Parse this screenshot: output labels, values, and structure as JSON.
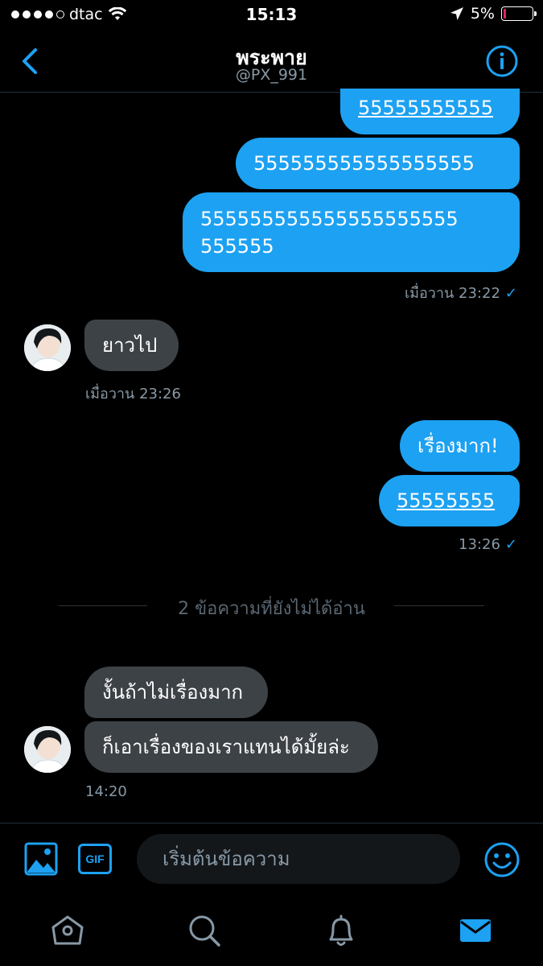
{
  "status_bar": {
    "carrier": "dtac",
    "time": "15:13",
    "battery": "5%",
    "accent_low_battery": "#e0245e"
  },
  "header": {
    "title": "พระพาย",
    "handle": "@PX_991",
    "back_icon": "chevron-left-icon",
    "info_icon": "info-icon"
  },
  "messages": [
    {
      "direction": "out",
      "text": "55555555555",
      "link": true
    },
    {
      "direction": "out",
      "text": "555555555555555555"
    },
    {
      "direction": "out",
      "text": "555555555555555555555",
      "text_line2": "555555"
    },
    {
      "meta": "เมื่อวาน 23:22",
      "checked": true
    },
    {
      "direction": "in",
      "text": "ยาวไป"
    },
    {
      "meta": "เมื่อวาน 23:26"
    },
    {
      "direction": "out",
      "text": "เรื่องมาก!"
    },
    {
      "direction": "out",
      "text": "55555555",
      "link": true
    },
    {
      "meta": "13:26",
      "checked": true
    },
    {
      "direction": "in",
      "text": "งั้นถ้าไม่เรื่องมาก"
    },
    {
      "direction": "in",
      "text": "ก็เอาเรื่องของเราแทนได้มั้ยล่ะ"
    },
    {
      "meta": "14:20"
    }
  ],
  "msg": {
    "m1": "55555555555",
    "m2": "555555555555555555",
    "m3a": "555555555555555555555",
    "m3b": "555555",
    "t1": "เมื่อวาน 23:22",
    "r1": "ยาวไป",
    "t2": "เมื่อวาน 23:26",
    "m4": "เรื่องมาก!",
    "m5": "55555555",
    "t3": "13:26",
    "r2": "งั้นถ้าไม่เรื่องมาก",
    "r3": "ก็เอาเรื่องของเราแทนได้มั้ยล่ะ",
    "t4": "14:20",
    "check": "✓"
  },
  "unread_divider": "2 ข้อความที่ยังไม่ได้อ่าน",
  "composer": {
    "placeholder": "เริ่มต้นข้อความ",
    "gif_label": "GIF",
    "image_icon": "image-icon",
    "emoji_icon": "emoji-icon"
  },
  "tab_bar": {
    "tabs": [
      "home-icon",
      "search-icon",
      "bell-icon",
      "mail-icon"
    ],
    "active": "mail-icon"
  },
  "colors": {
    "accent": "#1da1f2",
    "background": "#000000",
    "incoming_bubble": "#3d4247",
    "muted_text": "#8899a6"
  }
}
